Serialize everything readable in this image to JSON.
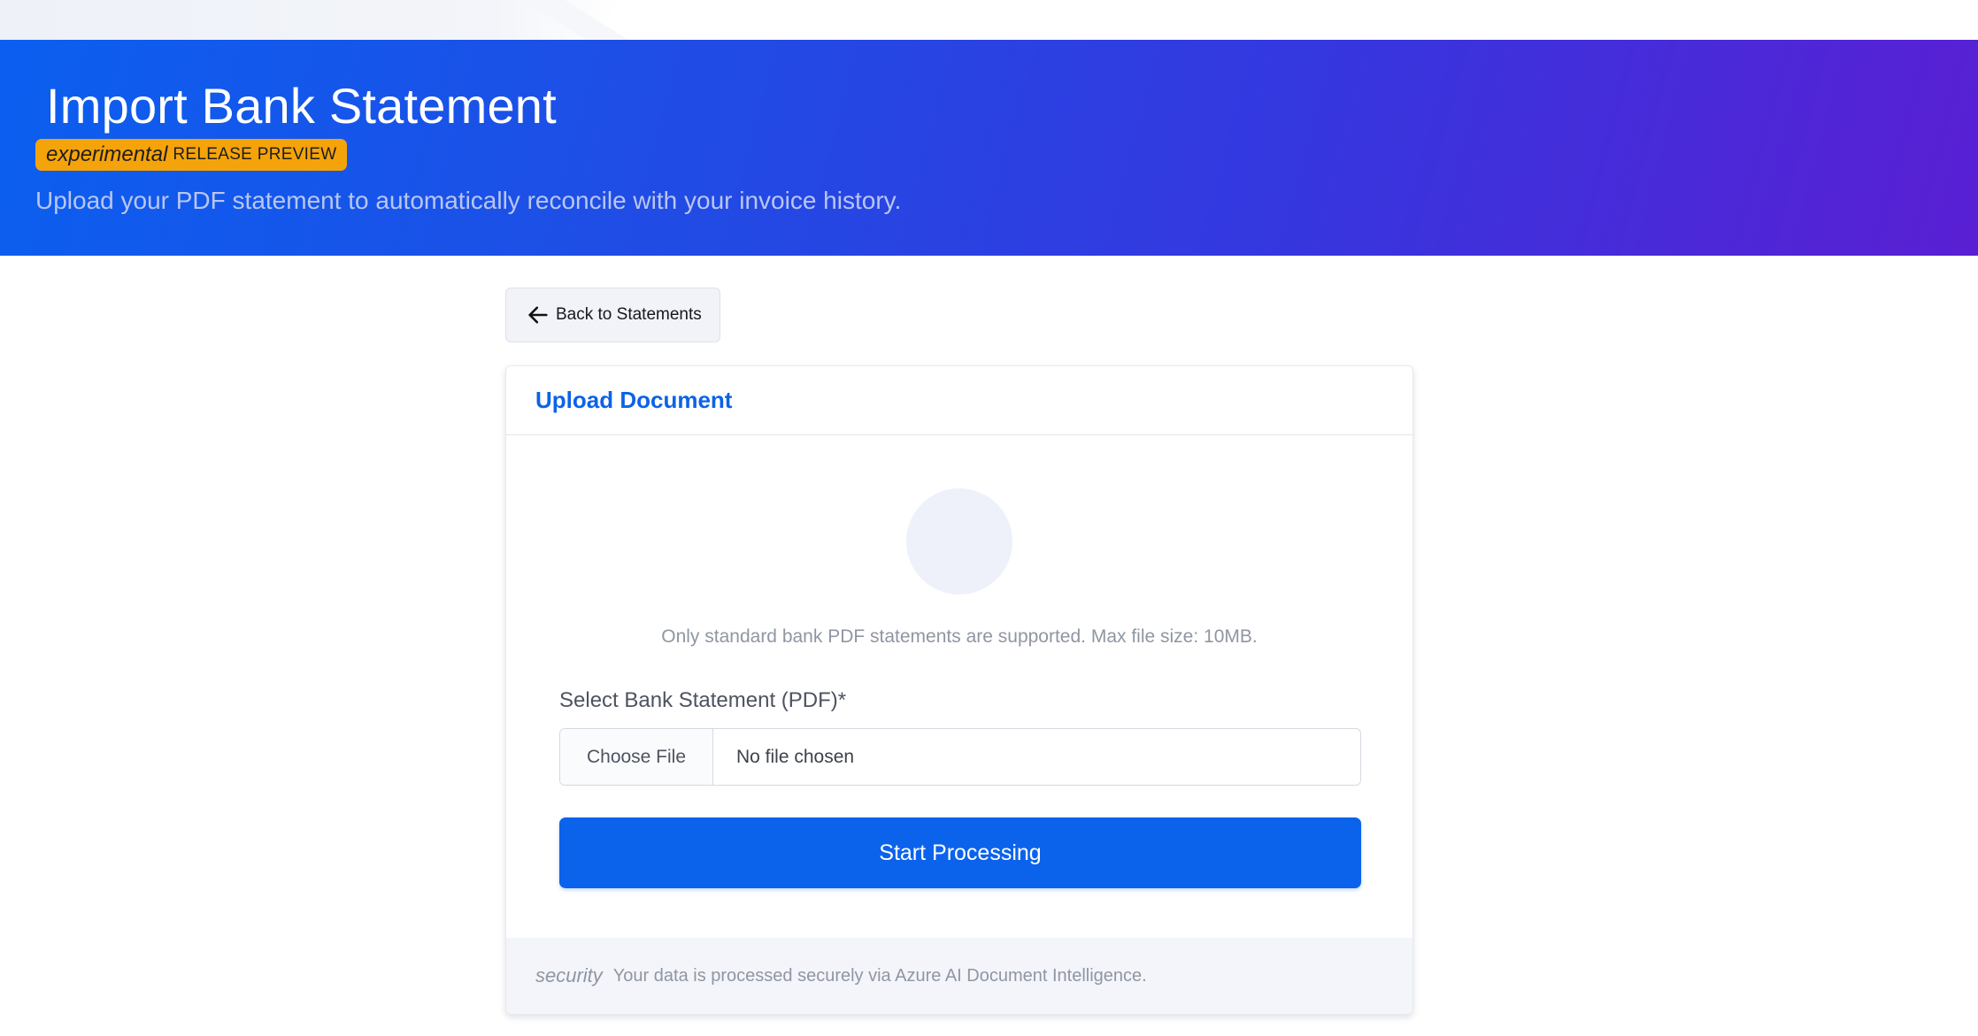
{
  "header": {
    "title": "Import Bank Statement",
    "badge_em": "experimental",
    "badge_text": "RELEASE PREVIEW",
    "subtitle": "Upload your PDF statement to automatically reconcile with your invoice history."
  },
  "nav": {
    "back_label": "Back to Statements",
    "back_icon": "arrow-left-icon"
  },
  "card": {
    "title": "Upload Document",
    "help_text": "Only standard bank PDF statements are supported. Max file size: 10MB.",
    "field_label": "Select Bank Statement (PDF)*",
    "file_button_label": "Choose File",
    "file_status": "No file chosen",
    "submit_label": "Start Processing",
    "footer_icon_text": "security",
    "footer_text": "Your data is processed securely via Azure AI Document Intelligence."
  },
  "colors": {
    "hero_start": "#0b5ff0",
    "hero_end": "#5a1fd3",
    "accent": "#0b63ec",
    "badge": "#f5a30a"
  }
}
